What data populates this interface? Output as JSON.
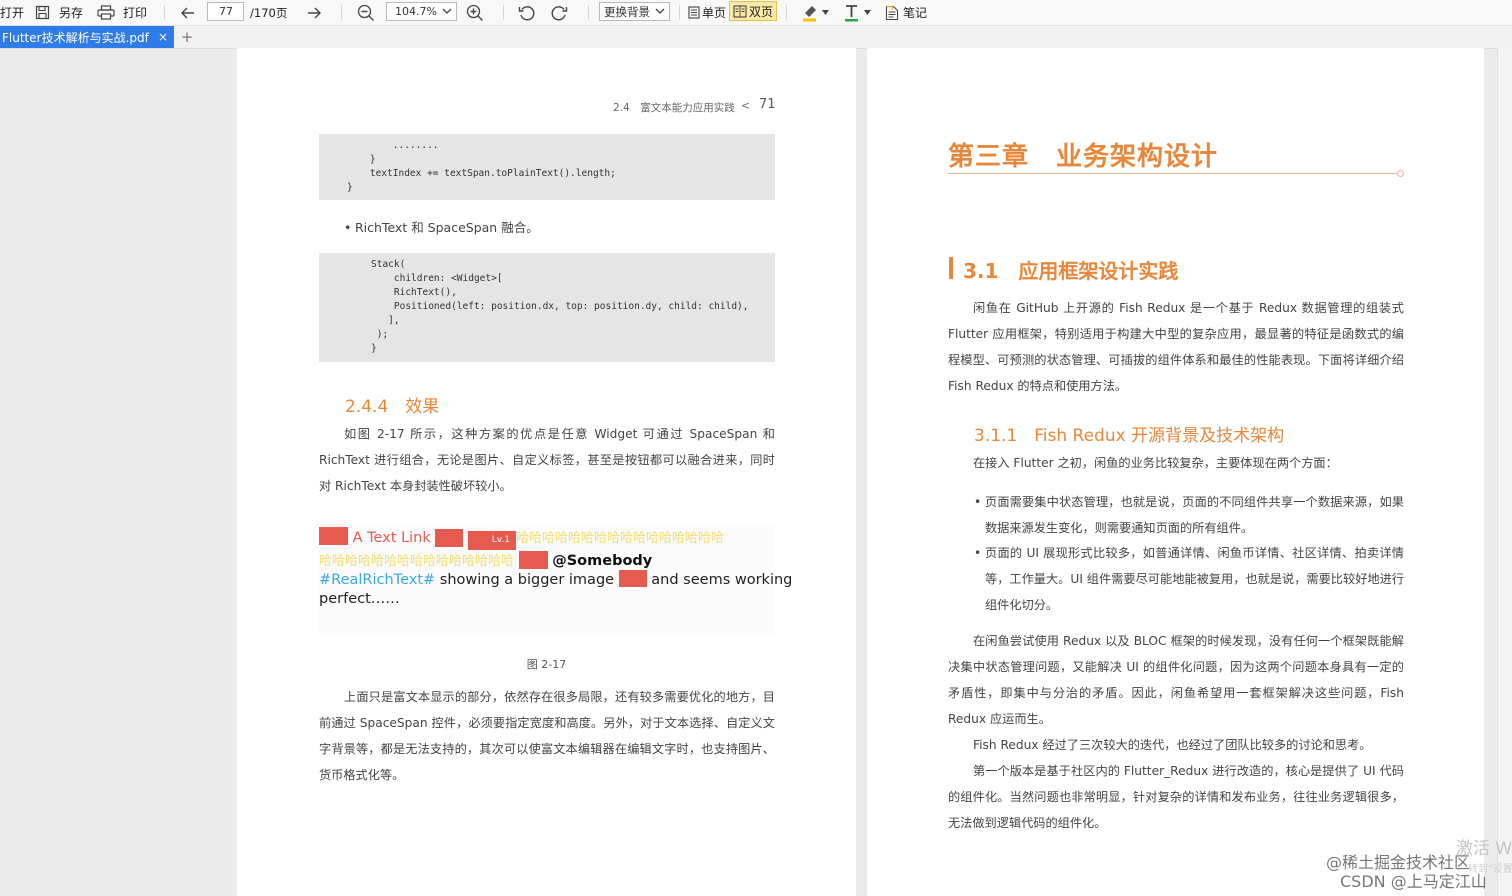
{
  "toolbar": {
    "open": "打开",
    "save_as": "另存",
    "print": "打印",
    "page_current": "77",
    "page_total": "/170页",
    "zoom": "104.7%",
    "change_bg": "更换背景",
    "single_page": "单页",
    "double_page": "双页",
    "note": "笔记"
  },
  "tab": {
    "title": "Flutter技术解析与实战.pdf",
    "close": "×",
    "new_tab": "+"
  },
  "left_page": {
    "header_section": "2.4　富文本能力应用实践",
    "header_sep": "<",
    "page_number": "71",
    "code1": [
      "        ........",
      "    }",
      "    textIndex += textSpan.toPlainText().length;",
      "}"
    ],
    "bullet1": "RichText 和 SpaceSpan 融合。",
    "code2": [
      "Stack(",
      "    children: <Widget>[",
      "    RichText(),",
      "    Positioned(left: position.dx, top: position.dy, child: child),",
      "   ],",
      " );",
      "}"
    ],
    "section_heading": "2.4.4　效果",
    "para1": "如图 2-17 所示，这种方案的优点是任意 Widget 可通过 SpaceSpan 和 RichText 进行组合，无论是图片、自定义标签，甚至是按钮都可以融合进来，同时对 RichText 本身封装性破坏较小。",
    "demo": {
      "text_link": "A Text Link",
      "lv_badge": "Lv.1",
      "haha_line1": "哈哈哈哈哈哈哈哈哈哈哈哈哈哈哈哈",
      "haha_line2": "哈哈哈哈哈哈哈哈哈哈哈哈哈哈哈",
      "mention": "@Somebody",
      "topic": "#RealRichText#",
      "showing": " showing a bigger image",
      "seems": "and seems working",
      "perfect": "perfect……"
    },
    "figure_caption": "图 2-17",
    "para2": "上面只是富文本显示的部分，依然存在很多局限，还有较多需要优化的地方，目前通过 SpaceSpan 控件，必须要指定宽度和高度。另外，对于文本选择、自定义文字背景等，都是无法支持的，其次可以使富文本编辑器在编辑文字时，也支持图片、货币格式化等。"
  },
  "right_page": {
    "chapter_title": "第三章　业务架构设计",
    "section_title": "3.1　应用框架设计实践",
    "para1": "闲鱼在 GitHub 上开源的 Fish Redux 是一个基于 Redux 数据管理的组装式 Flutter 应用框架，特别适用于构建大中型的复杂应用，最显著的特征是函数式的编程模型、可预测的状态管理、可插拔的组件体系和最佳的性能表现。下面将详细介绍 Fish Redux 的特点和使用方法。",
    "subsection_title": "3.1.1　Fish Redux 开源背景及技术架构",
    "para2": "在接入 Flutter 之初，闲鱼的业务比较复杂，主要体现在两个方面：",
    "bullet1": "页面需要集中状态管理，也就是说，页面的不同组件共享一个数据来源，如果数据来源发生变化，则需要通知页面的所有组件。",
    "bullet2": "页面的 UI 展现形式比较多，如普通详情、闲鱼币详情、社区详情、拍卖详情等，工作量大。UI 组件需要尽可能地能被复用，也就是说，需要比较好地进行组件化切分。",
    "para3": "在闲鱼尝试使用 Redux 以及 BLOC 框架的时候发现，没有任何一个框架既能解决集中状态管理问题，又能解决 UI 的组件化问题，因为这两个问题本身具有一定的矛盾性，即集中与分治的矛盾。因此，闲鱼希望用一套框架解决这些问题，Fish Redux 应运而生。",
    "para4": "Fish Redux 经过了三次较大的迭代，也经过了团队比较多的讨论和思考。",
    "para5": "第一个版本是基于社区内的 Flutter_Redux 进行改造的，核心是提供了 UI 代码的组件化。当然问题也非常明显，针对复杂的详情和发布业务，往往业务逻辑很多，无法做到逻辑代码的组件化。"
  },
  "watermarks": {
    "activate": "激活 W",
    "activate_sub": "转到\"设置\"",
    "juejin": "@稀土掘金技术社区",
    "csdn": "CSDN @上马定江山"
  },
  "colors": {
    "accent": "#e8863a",
    "tab_active": "#2f7ce8",
    "highlight_btn": "#fbe8a6",
    "red_chip": "#e75a50"
  }
}
